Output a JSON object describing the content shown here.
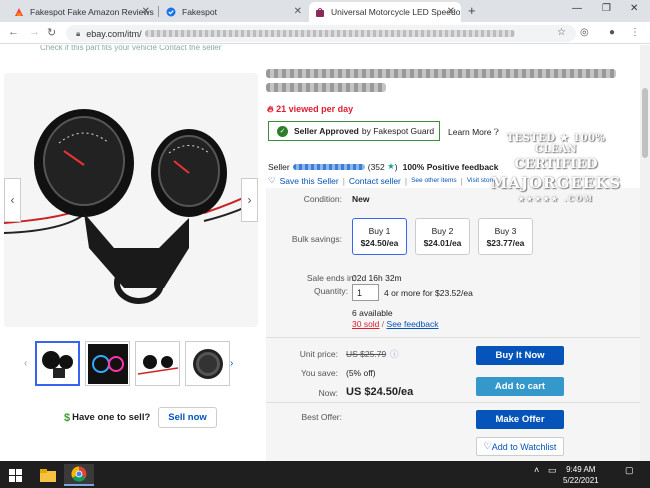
{
  "browser": {
    "tabs": [
      {
        "label": "Fakespot Fake Amazon Reviews a"
      },
      {
        "label": "Fakespot"
      },
      {
        "label": "Universal Motorcycle LED Speedo"
      }
    ],
    "url_prefix": "ebay.com/itm/"
  },
  "page": {
    "top_cut_text": "Check if this part fits your vehicle      Contact the seller",
    "viewed": "21 viewed per day",
    "guard_bold": "Seller Approved",
    "guard_rest": "by Fakespot Guard",
    "learn_more": "Learn More",
    "seller_label": "Seller",
    "seller_score_open": "(352",
    "seller_score_close": ")",
    "seller_feedback": "100% Positive feedback",
    "save_seller": "Save this Seller",
    "contact_seller": "Contact seller",
    "see_other_items": "See other items",
    "visit_store": "Visit store",
    "sell_question": "Have one to sell?",
    "sell_now": "Sell now",
    "condition_label": "Condition:",
    "condition_value": "New",
    "bulk_label": "Bulk savings:",
    "bulk": [
      {
        "qty": "Buy 1",
        "price": "$24.50/ea"
      },
      {
        "qty": "Buy 2",
        "price": "$24.01/ea"
      },
      {
        "qty": "Buy 3",
        "price": "$23.77/ea"
      }
    ],
    "sale_ends_label": "Sale ends in:",
    "sale_ends_value": "02d 16h 32m",
    "quantity_label": "Quantity:",
    "quantity_value": "1",
    "quantity_offer": "4 or more for $23.52/ea",
    "available": "6 available",
    "sold": "30 sold",
    "see_feedback": "See feedback",
    "unit_price_label": "Unit price:",
    "unit_price_value": "US $25.79",
    "you_save_label": "You save:",
    "you_save_value": "(5% off)",
    "now_label": "Now:",
    "now_value": "US $24.50/ea",
    "buy_now": "Buy It Now",
    "add_to_cart": "Add to cart",
    "best_offer_label": "Best Offer:",
    "make_offer": "Make Offer",
    "watchlist": "Add to Watchlist"
  },
  "watermark": {
    "line1": "TESTED ★ 100% CLEAN",
    "line2": "CERTIFIED",
    "line3": "MAJORGEEKS",
    "line4": "★★★★★ .COM"
  },
  "taskbar": {
    "time": "9:49 AM",
    "date": "5/22/2021"
  },
  "colors": {
    "ebay_blue": "#0654ba",
    "cart_blue": "#3498ca",
    "viewed_red": "#dd1e31",
    "guard_green": "#2d7d2d"
  }
}
